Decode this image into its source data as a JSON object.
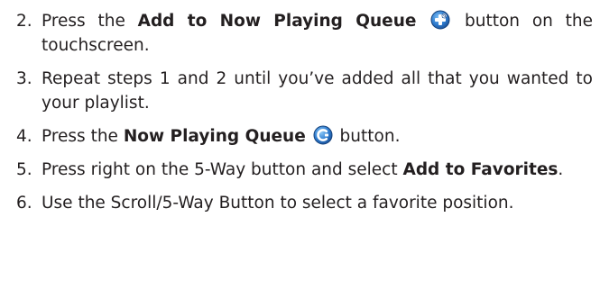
{
  "steps": [
    {
      "number": "2.",
      "segments": [
        {
          "text": "Press the "
        },
        {
          "text": "Add to Now Playing Queue",
          "bold": true
        },
        {
          "icon": "add-to-queue-icon"
        },
        {
          "text": " button on the touchscreen."
        }
      ]
    },
    {
      "number": "3.",
      "segments": [
        {
          "text": "Repeat steps 1 and 2 until you’ve added all that you wanted to your playlist."
        }
      ]
    },
    {
      "number": "4.",
      "segments": [
        {
          "text": "Press the "
        },
        {
          "text": "Now Playing Queue",
          "bold": true
        },
        {
          "icon": "now-playing-queue-icon"
        },
        {
          "text": " button."
        }
      ]
    },
    {
      "number": "5.",
      "segments": [
        {
          "text": "Press right on the 5-Way button and select "
        },
        {
          "text": "Add to Favorites",
          "bold": true
        },
        {
          "text": "."
        }
      ]
    },
    {
      "number": "6.",
      "segments": [
        {
          "text": "Use the Scroll/5-Way Button to select a favorite position."
        }
      ]
    }
  ],
  "colors": {
    "text": "#231f20",
    "icon_blue": "#2e7ccf",
    "icon_dark_blue": "#1b4f95"
  }
}
